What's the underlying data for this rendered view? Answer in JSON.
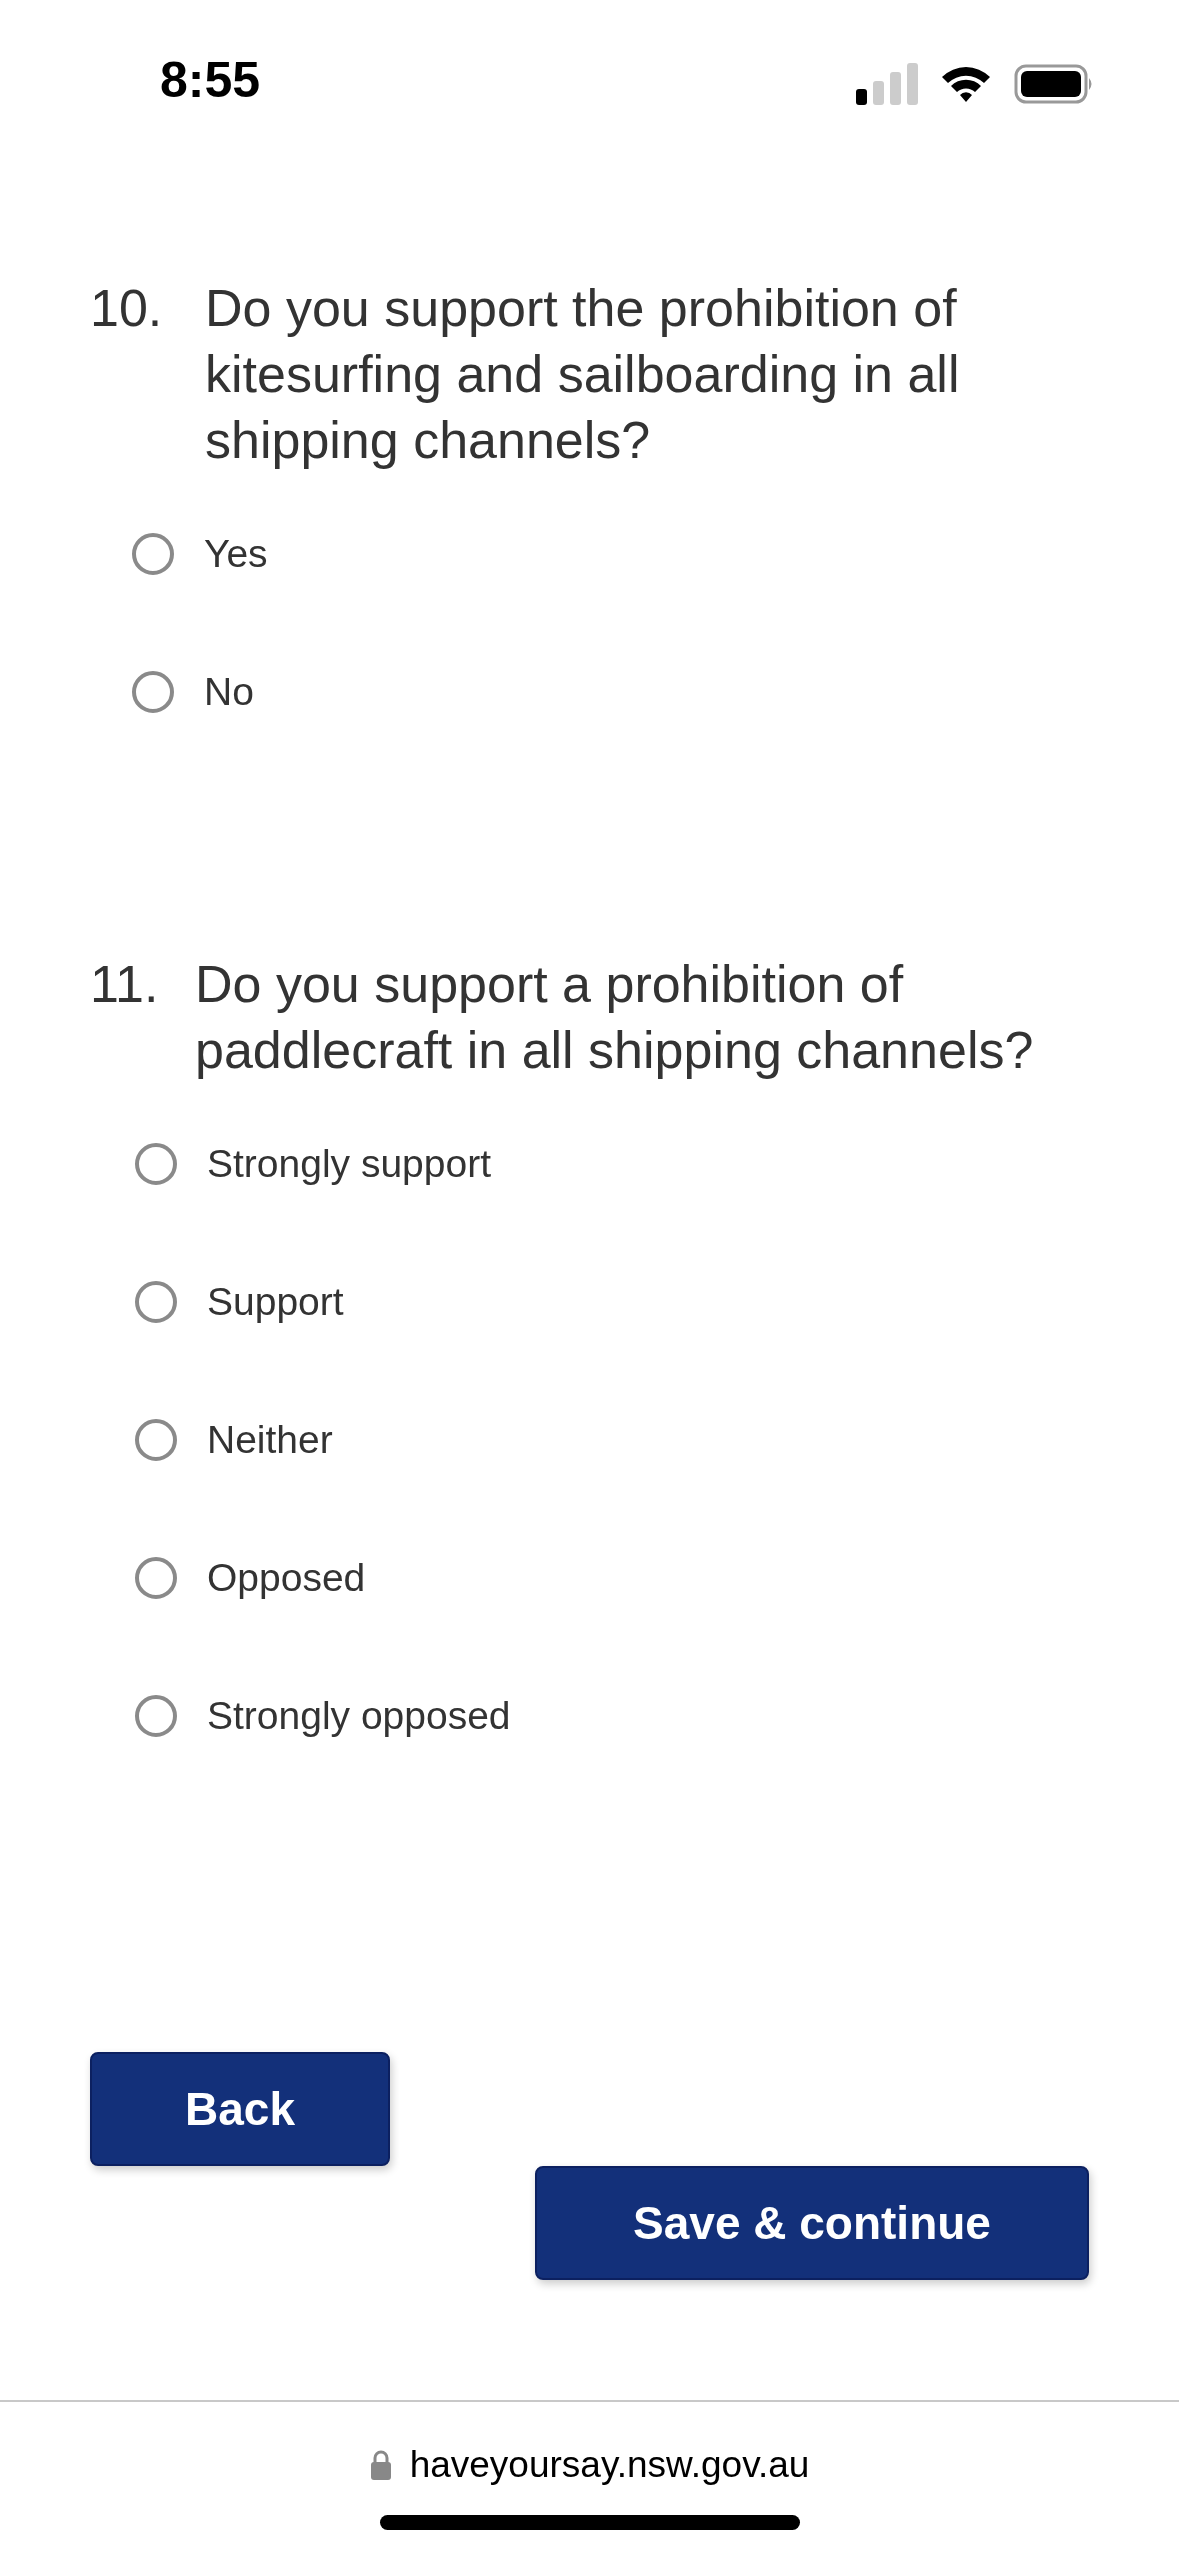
{
  "status_bar": {
    "time": "8:55"
  },
  "questions": [
    {
      "number": "10.",
      "text": "Do you support the prohibition of kitesurfing and sailboarding in all shipping channels?",
      "options": [
        {
          "label": "Yes",
          "selected": false
        },
        {
          "label": "No",
          "selected": false
        }
      ]
    },
    {
      "number": "11.",
      "text": "Do you support a prohibition of paddlecraft in all shipping channels?",
      "options": [
        {
          "label": "Strongly support",
          "selected": false
        },
        {
          "label": "Support",
          "selected": false
        },
        {
          "label": "Neither",
          "selected": false
        },
        {
          "label": "Opposed",
          "selected": false
        },
        {
          "label": "Strongly opposed",
          "selected": false
        }
      ]
    }
  ],
  "buttons": [
    {
      "label": "Back",
      "kind": "back"
    },
    {
      "label": "Save & continue",
      "kind": "next"
    }
  ],
  "browser": {
    "url": "haveyoursay.nsw.gov.au"
  }
}
